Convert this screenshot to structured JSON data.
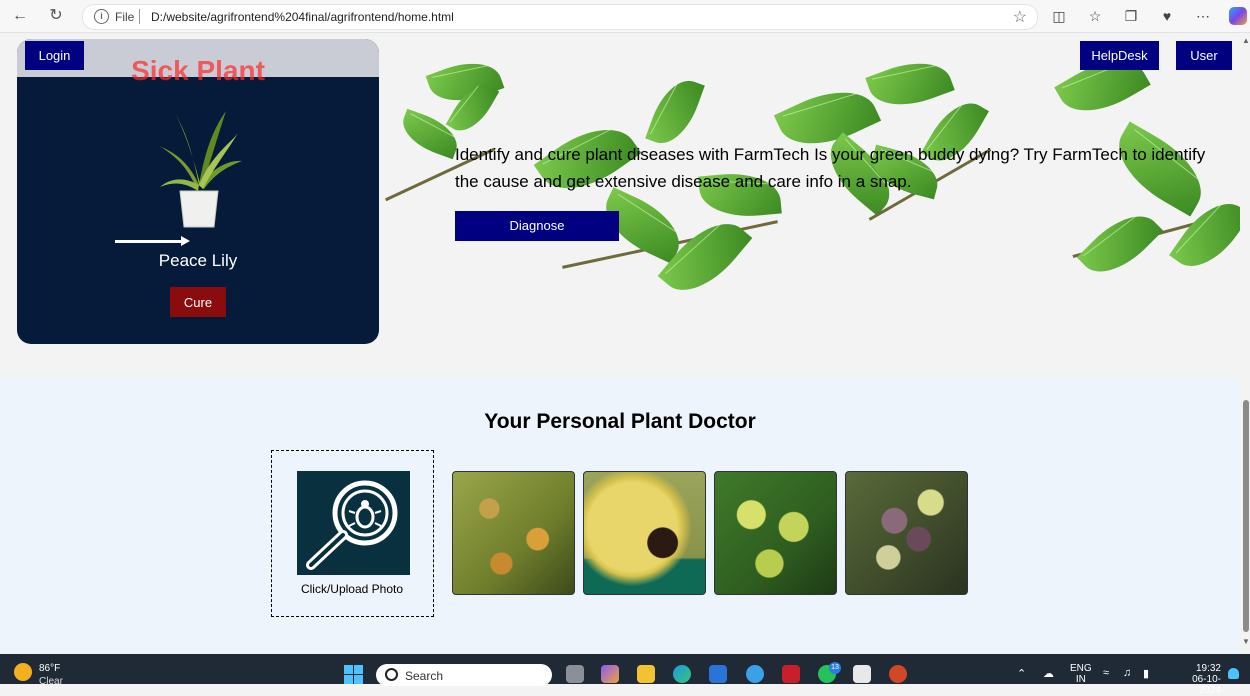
{
  "browser": {
    "address_scheme": "File",
    "address_url": "D:/website/agrifrontend%204final/agrifrontend/home.html"
  },
  "nav": {
    "login": "Login",
    "helpdesk": "HelpDesk",
    "user": "User"
  },
  "card": {
    "title": "Sick Plant",
    "plant_name": "Peace Lily",
    "cure_button": "Cure"
  },
  "hero": {
    "text": "Identify and cure plant diseases with FarmTech Is your green buddy dying? Try FarmTech to identify the cause and get extensive disease and care info in a snap.",
    "diagnose_button": "Diagnose"
  },
  "doctor": {
    "title": "Your Personal Plant Doctor",
    "upload_label": "Click/Upload Photo"
  },
  "taskbar": {
    "temperature": "86°F",
    "condition": "Clear",
    "search_placeholder": "Search",
    "whatsapp_badge": "13",
    "lang_top": "ENG",
    "lang_bottom": "IN",
    "time": "19:32",
    "date": "06-10-2024"
  },
  "icons": [
    "back-icon",
    "refresh-icon",
    "info-icon",
    "favorite-star-icon",
    "split-screen-icon",
    "favorites-icon",
    "collections-icon",
    "browser-essentials-icon",
    "more-icon",
    "copilot-icon",
    "search-bug-icon",
    "weather-moon-icon",
    "windows-start-icon",
    "search-icon",
    "bell-icon"
  ],
  "colors": {
    "nav_button": "#000080",
    "card_bg": "#061a3a",
    "cure_button": "#8b0c0c",
    "card_title": "#ff2a2a",
    "section_bg": "#eef4fb",
    "upload_icon_bg": "#08303f"
  }
}
